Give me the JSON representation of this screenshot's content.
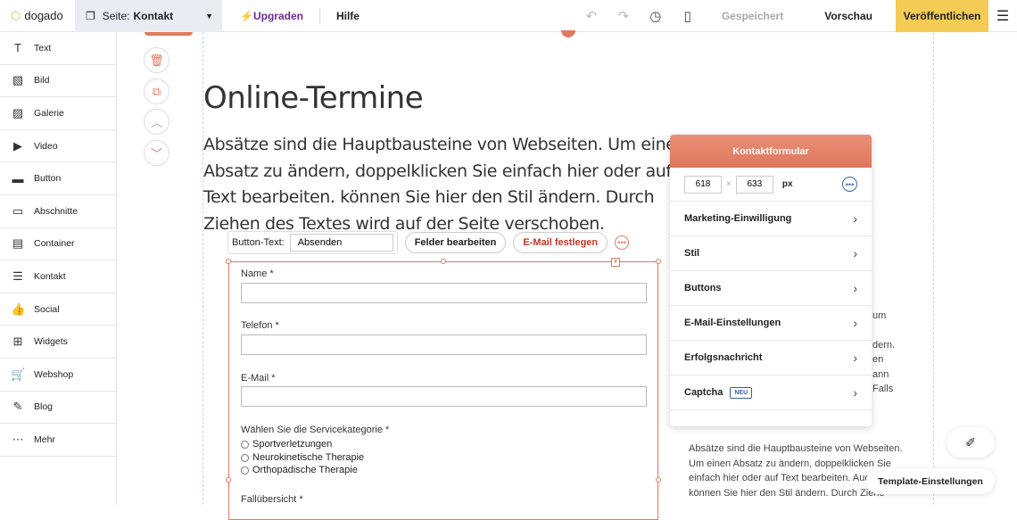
{
  "topbar": {
    "logo": "dogado",
    "page_prefix": "Seite:",
    "page_name": "Kontakt",
    "upgrade": "Upgraden",
    "help": "Hilfe",
    "saved": "Gespeichert",
    "preview": "Vorschau",
    "publish": "Veröffentlichen"
  },
  "sidebar": {
    "items": [
      {
        "label": "Text",
        "icon": "T"
      },
      {
        "label": "Bild",
        "icon": "▧"
      },
      {
        "label": "Galerie",
        "icon": "▨"
      },
      {
        "label": "Video",
        "icon": "▶"
      },
      {
        "label": "Button",
        "icon": "▬"
      },
      {
        "label": "Abschnitte",
        "icon": "▭"
      },
      {
        "label": "Container",
        "icon": "▤"
      },
      {
        "label": "Kontakt",
        "icon": "☰"
      },
      {
        "label": "Social",
        "icon": "👍"
      },
      {
        "label": "Widgets",
        "icon": "⊞"
      },
      {
        "label": "Webshop",
        "icon": "🛒"
      },
      {
        "label": "Blog",
        "icon": "✎"
      },
      {
        "label": "Mehr",
        "icon": "⋯"
      }
    ]
  },
  "content": {
    "title": "Online-Termine",
    "paragraph": "Absätze sind die Hauptbausteine von Webseiten. Um einen Absatz zu ändern, doppelklicken Sie einfach hier oder auf Text bearbeiten. können Sie hier den Stil ändern. Durch Ziehen des Textes wird auf der Seite verschoben.",
    "right_fragments": [
      "um",
      "dern.",
      "en",
      "ann",
      "Falls"
    ],
    "right_paragraph": [
      "Absätze sind die Hauptbausteine von Webseiten.",
      "Um einen Absatz zu ändern, doppelklicken Sie",
      "einfach hier oder auf Text bearbeiten. Auc'",
      "können Sie hier den Stil ändern. Durch Ziehe"
    ]
  },
  "button_toolbar": {
    "label": "Button-Text:",
    "value": "Absenden",
    "edit_fields": "Felder bearbeiten",
    "set_email": "E-Mail festlegen"
  },
  "form": {
    "fields": [
      {
        "label": "Name *"
      },
      {
        "label": "Telefon *"
      },
      {
        "label": "E-Mail *"
      }
    ],
    "category_label": "Wählen Sie die Servicekategorie *",
    "options": [
      "Sportverletzungen",
      "Neurokinetische Therapie",
      "Orthopädische Therapie"
    ],
    "summary_label": "Fallübersicht *"
  },
  "panel": {
    "title": "Kontaktformular",
    "width": "618",
    "height": "633",
    "unit": "px",
    "rows": [
      {
        "label": "Marketing-Einwilligung"
      },
      {
        "label": "Stil"
      },
      {
        "label": "Buttons"
      },
      {
        "label": "E-Mail-Einstellungen"
      },
      {
        "label": "Erfolgsnachricht"
      },
      {
        "label": "Captcha",
        "badge": "NEU"
      }
    ]
  },
  "template_settings": "Template-Einstellungen",
  "colors": {
    "accent": "#e07a5f",
    "publish": "#f4cb55",
    "upgrade": "#6b2c91",
    "link": "#3465a4"
  }
}
